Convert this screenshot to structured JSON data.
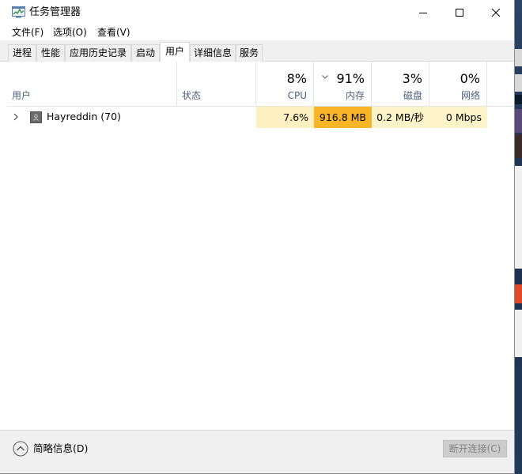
{
  "window": {
    "title": "任务管理器"
  },
  "menu": {
    "items": [
      "文件(F)",
      "选项(O)",
      "查看(V)"
    ]
  },
  "tabs": {
    "items": [
      "进程",
      "性能",
      "应用历史记录",
      "启动",
      "用户",
      "详细信息",
      "服务"
    ],
    "active": "用户"
  },
  "columns": {
    "user": "用户",
    "status": "状态",
    "cpu": {
      "percent": "8%",
      "label": "CPU"
    },
    "memory": {
      "percent": "91%",
      "label": "内存",
      "sorted": true
    },
    "disk": {
      "percent": "3%",
      "label": "磁盘"
    },
    "network": {
      "percent": "0%",
      "label": "网络"
    }
  },
  "rows": [
    {
      "user": "Hayreddin (70)",
      "status": "",
      "cpu": "7.6%",
      "memory": "916.8 MB",
      "disk": "0.2 MB/秒",
      "network": "0 Mbps"
    }
  ],
  "footer": {
    "fewer_details": "简略信息(D)",
    "disconnect": "断开连接(C)"
  },
  "colors": {
    "heat_light": "#fcf0c0",
    "heat_high": "#f9b528",
    "header_label": "#4c607a"
  },
  "icons": {
    "app": "task-manager-icon",
    "expand": "chevron-right-icon",
    "user": "user-avatar-icon",
    "fewer": "chevron-up-circle-icon"
  }
}
